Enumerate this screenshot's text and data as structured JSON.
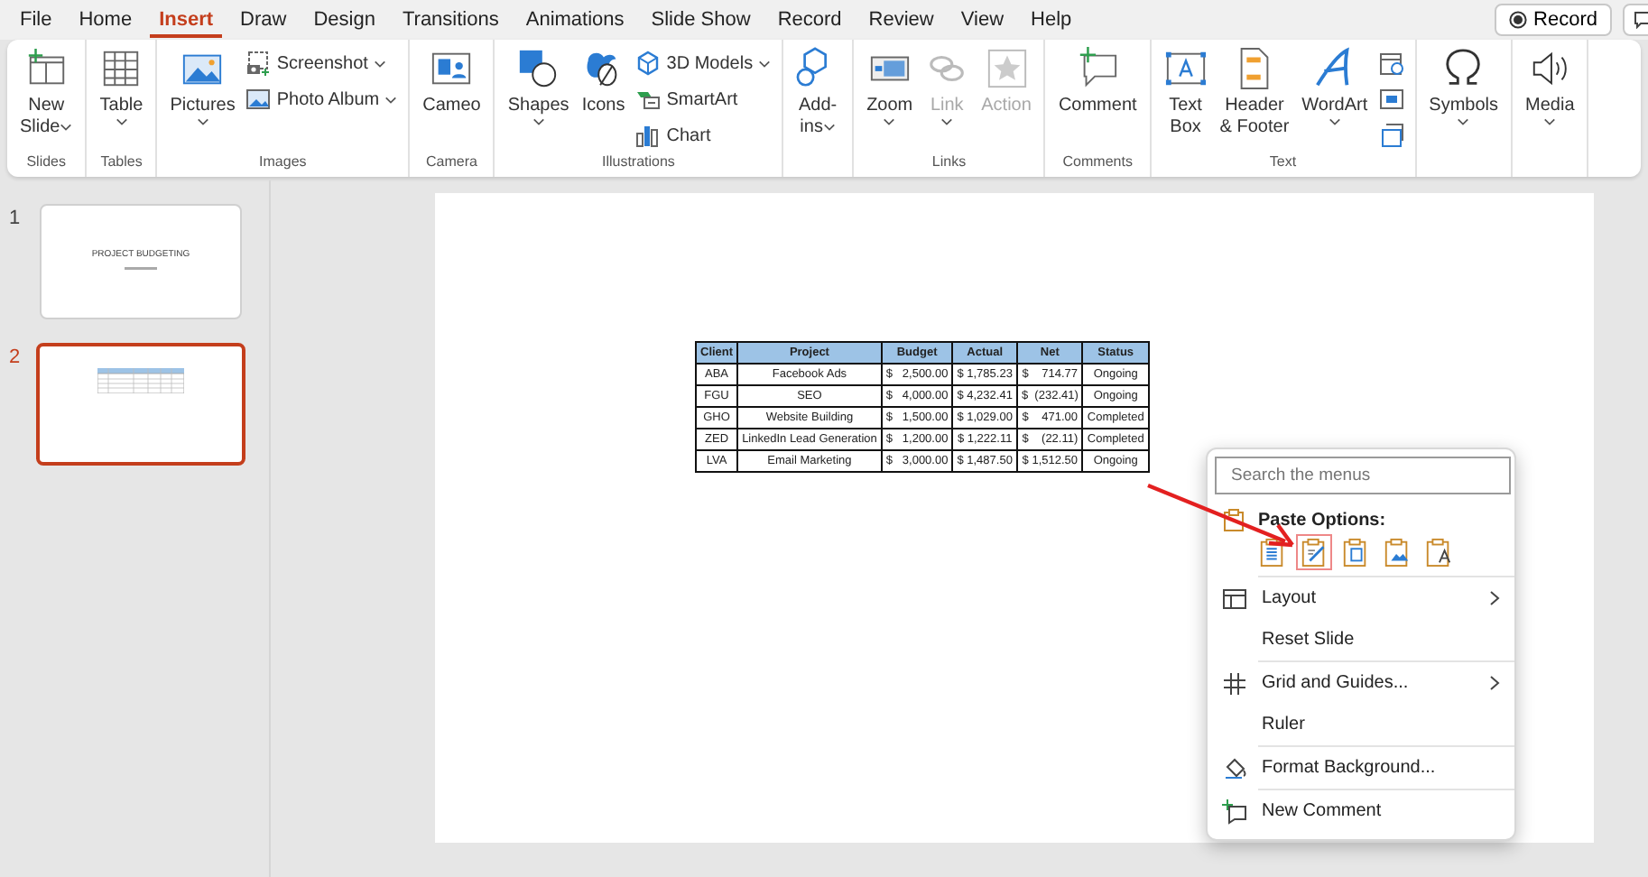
{
  "tabs": [
    {
      "label": "File",
      "selected": false
    },
    {
      "label": "Home",
      "selected": false
    },
    {
      "label": "Insert",
      "selected": true
    },
    {
      "label": "Draw",
      "selected": false
    },
    {
      "label": "Design",
      "selected": false
    },
    {
      "label": "Transitions",
      "selected": false
    },
    {
      "label": "Animations",
      "selected": false
    },
    {
      "label": "Slide Show",
      "selected": false
    },
    {
      "label": "Record",
      "selected": false
    },
    {
      "label": "Review",
      "selected": false
    },
    {
      "label": "View",
      "selected": false
    },
    {
      "label": "Help",
      "selected": false
    }
  ],
  "record_button": {
    "label": "Record"
  },
  "ribbon": {
    "groups": [
      {
        "label": "Slides",
        "items": [
          {
            "kind": "large",
            "label": "New\nSlide",
            "dropdown": true,
            "caret_inline": true
          }
        ]
      },
      {
        "label": "Tables",
        "items": [
          {
            "kind": "large",
            "label": "Table",
            "dropdown": true
          }
        ]
      },
      {
        "label": "Images",
        "items": [
          {
            "kind": "large",
            "label": "Pictures",
            "dropdown": true
          },
          {
            "kind": "stack",
            "items": [
              {
                "label": "Screenshot",
                "dropdown": true
              },
              {
                "label": "Photo Album",
                "dropdown": true
              }
            ]
          }
        ]
      },
      {
        "label": "Camera",
        "items": [
          {
            "kind": "large",
            "label": "Cameo"
          }
        ]
      },
      {
        "label": "Illustrations",
        "items": [
          {
            "kind": "large",
            "label": "Shapes",
            "dropdown": true
          },
          {
            "kind": "large",
            "label": "Icons"
          },
          {
            "kind": "stack",
            "items": [
              {
                "label": "3D Models",
                "dropdown": true
              },
              {
                "label": "SmartArt"
              },
              {
                "label": "Chart"
              }
            ]
          }
        ]
      },
      {
        "items": [
          {
            "kind": "large",
            "label": "Add-\nins",
            "dropdown": true,
            "caret_inline": true
          }
        ]
      },
      {
        "label": "Links",
        "items": [
          {
            "kind": "large",
            "label": "Zoom",
            "dropdown": true
          },
          {
            "kind": "large",
            "label": "Link",
            "dropdown": true,
            "disabled": true
          },
          {
            "kind": "large",
            "label": "Action",
            "disabled": true
          }
        ]
      },
      {
        "label": "Comments",
        "items": [
          {
            "kind": "large",
            "label": "Comment"
          }
        ]
      },
      {
        "label": "Text",
        "items": [
          {
            "kind": "large",
            "label": "Text\nBox"
          },
          {
            "kind": "large",
            "label": "Header\n& Footer"
          },
          {
            "kind": "large",
            "label": "WordArt",
            "dropdown": true
          },
          {
            "kind": "stack",
            "items": [
              {
                "kind": "icon"
              },
              {
                "kind": "icon"
              },
              {
                "kind": "icon"
              }
            ]
          }
        ]
      },
      {
        "items": [
          {
            "kind": "large",
            "label": "Symbols",
            "dropdown": true
          }
        ]
      },
      {
        "items": [
          {
            "kind": "large",
            "label": "Media",
            "dropdown": true
          }
        ]
      }
    ]
  },
  "thumbnails": [
    {
      "number": "1",
      "selected": false,
      "title": "PROJECT BUDGETING"
    },
    {
      "number": "2",
      "selected": true
    }
  ],
  "table": {
    "columns": [
      "Client",
      "Project",
      "Budget",
      "Actual",
      "Net",
      "Status"
    ],
    "rows": [
      [
        "ABA",
        "Facebook Ads",
        "$   2,500.00",
        "$ 1,785.23",
        "$    714.77",
        "Ongoing"
      ],
      [
        "FGU",
        "SEO",
        "$   4,000.00",
        "$ 4,232.41",
        "$  (232.41)",
        "Ongoing"
      ],
      [
        "GHO",
        "Website Building",
        "$   1,500.00",
        "$ 1,029.00",
        "$    471.00",
        "Completed"
      ],
      [
        "ZED",
        "LinkedIn Lead Generation",
        "$   1,200.00",
        "$ 1,222.11",
        "$    (22.11)",
        "Completed"
      ],
      [
        "LVA",
        "Email Marketing",
        "$   3,000.00",
        "$ 1,487.50",
        "$ 1,512.50",
        "Ongoing"
      ]
    ]
  },
  "context_menu": {
    "search": {
      "placeholder": "Search the menus"
    },
    "paste_options": {
      "label": "Paste Options:",
      "buttons": [
        {
          "selected": false
        },
        {
          "selected": true
        },
        {
          "selected": false
        },
        {
          "selected": false
        },
        {
          "selected": false
        }
      ]
    },
    "items": [
      {
        "label": "Layout",
        "submenu": true,
        "divider_before": true
      },
      {
        "label": "Reset Slide",
        "submenu": false
      },
      {
        "label": "Grid and Guides...",
        "submenu": true,
        "divider_before": true
      },
      {
        "label": "Ruler",
        "submenu": false
      },
      {
        "label": "Format Background...",
        "submenu": false,
        "divider_before": true
      },
      {
        "label": "New Comment",
        "submenu": false,
        "divider_before": true
      }
    ]
  }
}
